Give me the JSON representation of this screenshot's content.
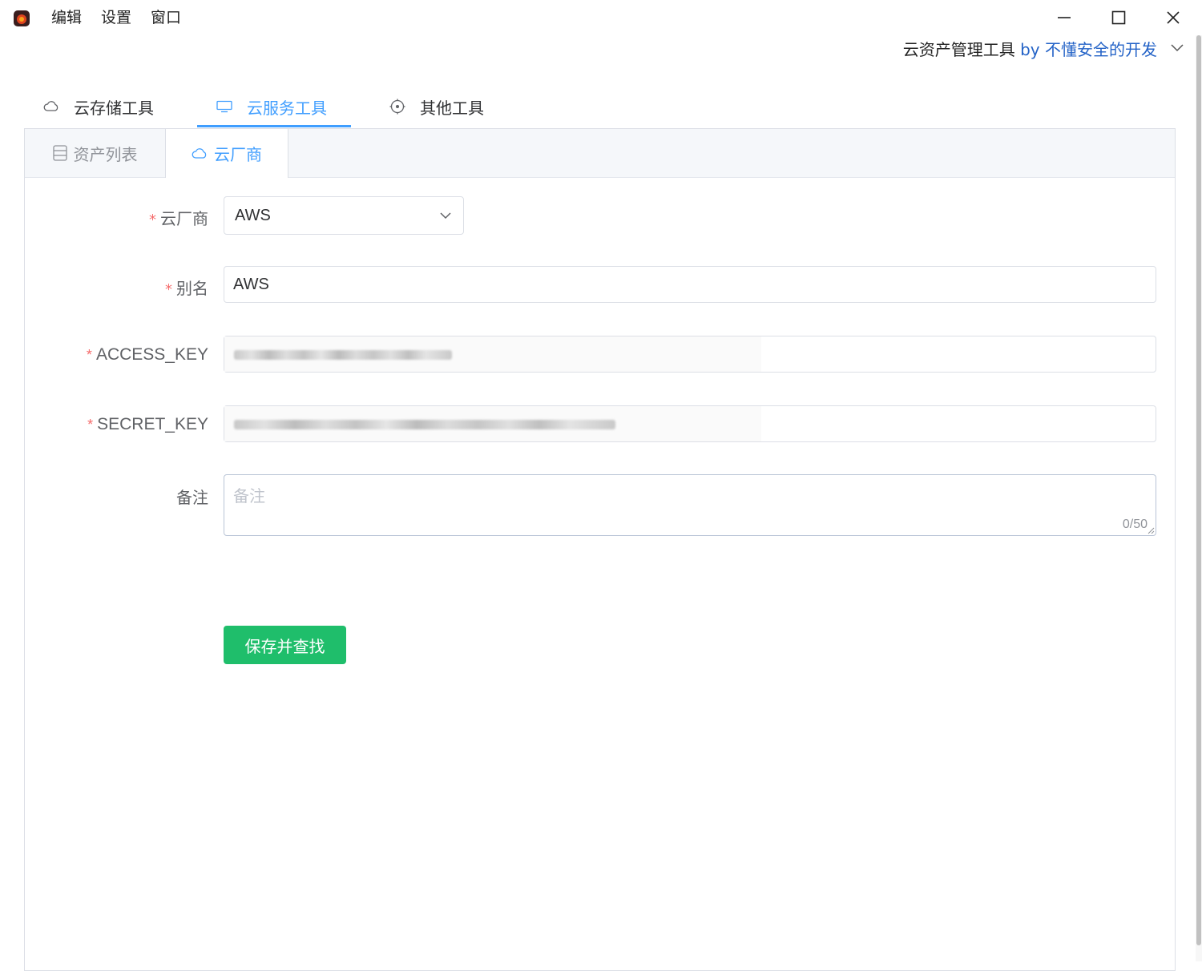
{
  "menu": {
    "items": [
      "编辑",
      "设置",
      "窗口"
    ]
  },
  "window": {
    "subtitle_main": "云资产管理工具",
    "subtitle_by": "by 不懂安全的开发"
  },
  "top_tabs": [
    {
      "label": "云存储工具",
      "icon": "cloud-icon"
    },
    {
      "label": "云服务工具",
      "icon": "monitor-icon",
      "active": true
    },
    {
      "label": "其他工具",
      "icon": "target-icon"
    }
  ],
  "sub_tabs": [
    {
      "label": "资产列表",
      "icon": "database-icon"
    },
    {
      "label": "云厂商",
      "icon": "cloud-icon",
      "active": true
    }
  ],
  "form": {
    "required_mark": "*",
    "vendor_label": "云厂商",
    "vendor_value": "AWS",
    "alias_label": "别名",
    "alias_value": "AWS",
    "access_key_label": "ACCESS_KEY",
    "secret_key_label": "SECRET_KEY",
    "remark_label": "备注",
    "remark_placeholder": "备注",
    "remark_counter": "0/50",
    "save_button": "保存并查找"
  },
  "colors": {
    "accent": "#409eff",
    "success_button": "#1fbe6b",
    "required": "#f56c6c"
  }
}
